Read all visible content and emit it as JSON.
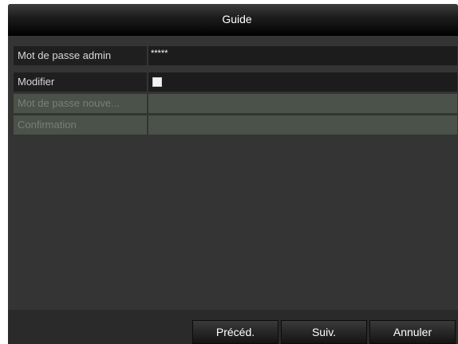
{
  "dialog": {
    "title": "Guide"
  },
  "form": {
    "admin_password": {
      "label": "Mot de passe admin",
      "value": "*****"
    },
    "modify": {
      "label": "Modifier",
      "checked": false
    },
    "new_password": {
      "label": "Mot de passe nouve...",
      "value": "",
      "enabled": false
    },
    "confirmation": {
      "label": "Confirmation",
      "value": "",
      "enabled": false
    }
  },
  "buttons": {
    "previous": "Précéd.",
    "next": "Suiv.",
    "cancel": "Annuler"
  },
  "colors": {
    "title_bar": "#000000",
    "panel": "#343434",
    "field": "#1c1c1c",
    "disabled_field": "#4b5249",
    "text": "#ffffff"
  }
}
